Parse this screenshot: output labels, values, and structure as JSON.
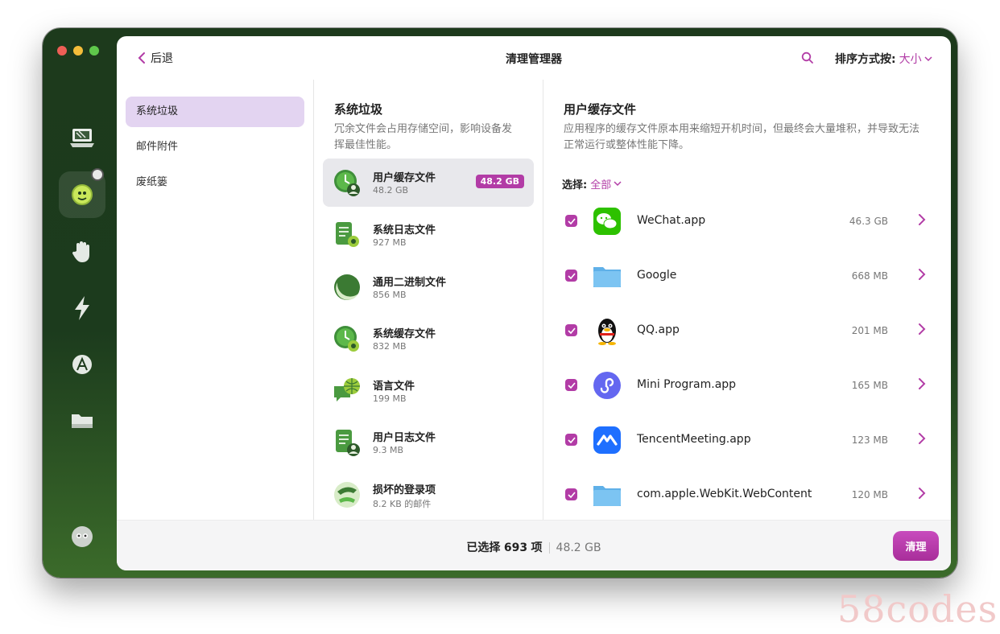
{
  "window": {
    "traffic_lights": [
      "close",
      "minimize",
      "zoom"
    ],
    "rail_icons": [
      "laptop-icon",
      "smart-scan-icon",
      "hand-icon",
      "lightning-icon",
      "applications-icon",
      "folder-icon",
      "assistant-icon"
    ]
  },
  "header": {
    "back_label": "后退",
    "title": "清理管理器",
    "sort_label": "排序方式按:",
    "sort_value": "大小"
  },
  "nav": {
    "items": [
      {
        "label": "系统垃圾",
        "active": true
      },
      {
        "label": "邮件附件",
        "active": false
      },
      {
        "label": "废纸篓",
        "active": false
      }
    ]
  },
  "categories": {
    "title": "系统垃圾",
    "description_line1": "冗余文件会占用存储空间，影响设备发",
    "description_line2": "挥最佳性能。",
    "items": [
      {
        "name": "用户缓存文件",
        "size": "48.2 GB",
        "badge": "48.2 GB",
        "active": true,
        "icon": "clock-user-icon"
      },
      {
        "name": "系统日志文件",
        "size": "927 MB",
        "icon": "log-gear-icon"
      },
      {
        "name": "通用二进制文件",
        "size": "856 MB",
        "icon": "binary-icon"
      },
      {
        "name": "系统缓存文件",
        "size": "832 MB",
        "icon": "clock-gear-icon"
      },
      {
        "name": "语言文件",
        "size": "199 MB",
        "icon": "globe-chat-icon"
      },
      {
        "name": "用户日志文件",
        "size": "9.3 MB",
        "icon": "log-user-icon"
      },
      {
        "name": "损坏的登录项",
        "size": "8.2 KB 的邮件",
        "icon": "broken-login-icon"
      }
    ]
  },
  "details": {
    "title": "用户缓存文件",
    "description_line1": "应用程序的缓存文件原本用来缩短开机时间，但最终会大量堆积，并导致无法",
    "description_line2": "正常运行或整体性能下降。",
    "select_label": "选择:",
    "select_value": "全部",
    "apps": [
      {
        "name": "WeChat.app",
        "size": "46.3 GB",
        "icon": "wechat-icon"
      },
      {
        "name": "Google",
        "size": "668 MB",
        "icon": "folder-icon"
      },
      {
        "name": "QQ.app",
        "size": "201 MB",
        "icon": "qq-penguin-icon"
      },
      {
        "name": "Mini Program.app",
        "size": "165 MB",
        "icon": "mini-program-icon"
      },
      {
        "name": "TencentMeeting.app",
        "size": "123 MB",
        "icon": "tencent-meeting-icon"
      },
      {
        "name": "com.apple.WebKit.WebContent",
        "size": "120 MB",
        "icon": "folder-icon"
      }
    ]
  },
  "footer": {
    "selected_prefix": "已选择",
    "selected_count": "693",
    "selected_suffix": "项",
    "total_size": "48.2 GB",
    "clean_label": "清理"
  },
  "watermark": "58codes",
  "colors": {
    "accent": "#b23ca6",
    "window_green": "#1d3a1c"
  }
}
